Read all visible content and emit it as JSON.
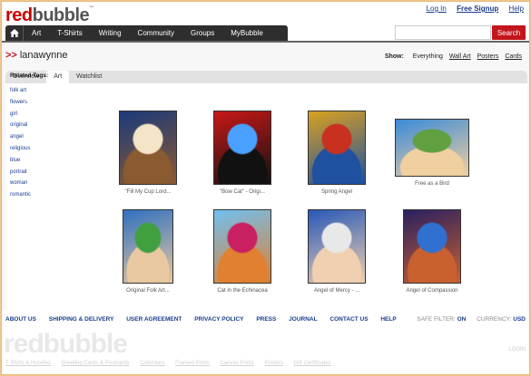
{
  "brand": {
    "part1": "red",
    "part2": "bubble",
    "mark": "™"
  },
  "top_links": [
    "Log In",
    "Free Signup",
    "Help"
  ],
  "nav": {
    "home_icon": "home-icon",
    "items": [
      "Art",
      "T-Shirts",
      "Writing",
      "Community",
      "Groups",
      "MyBubble"
    ]
  },
  "search": {
    "placeholder": "",
    "button": "Search"
  },
  "user": {
    "arrows": ">>",
    "name": "lanawynne"
  },
  "tabs": [
    "Overview",
    "Art",
    "Watchlist"
  ],
  "show": {
    "label": "Show:",
    "options": [
      "Everything",
      "Wall Art",
      "Posters",
      "Cards"
    ]
  },
  "tags": {
    "heading": "Related Tags:",
    "items": [
      "folk art",
      "flowers",
      "girl",
      "original",
      "angel",
      "religious",
      "blue",
      "portrait",
      "woman",
      "romantic"
    ]
  },
  "artworks": [
    {
      "caption": "\"Fill My Cup Lord...",
      "colors": [
        "#1c3a7a",
        "#8a5a30",
        "#f4e4c8"
      ]
    },
    {
      "caption": "\"Bow Cat\" - Origi...",
      "colors": [
        "#c81818",
        "#111111",
        "#4aa0ff"
      ]
    },
    {
      "caption": "Spring Angel",
      "colors": [
        "#d8a020",
        "#2050a0",
        "#c83020"
      ]
    },
    {
      "caption": "Free as a Bird",
      "colors": [
        "#3a8ad8",
        "#f0d0a0",
        "#60a040"
      ]
    },
    {
      "caption": "Original Folk Art...",
      "colors": [
        "#3070c0",
        "#e8c8a0",
        "#40a040"
      ]
    },
    {
      "caption": "Cat in the Echinacea",
      "colors": [
        "#70c0f0",
        "#e08030",
        "#c82060"
      ]
    },
    {
      "caption": "Angel of Mercy - ...",
      "colors": [
        "#2858b8",
        "#f0d0b0",
        "#e8e8e8"
      ]
    },
    {
      "caption": "Angel of Compassion",
      "colors": [
        "#2a2060",
        "#c86030",
        "#3070d0"
      ]
    }
  ],
  "footer": {
    "links": [
      "ABOUT US",
      "SHIPPING & DELIVERY",
      "USER AGREEMENT",
      "PRIVACY POLICY",
      "PRESS",
      "JOURNAL",
      "CONTACT US",
      "HELP"
    ],
    "safe_filter_label": "SAFE FILTER:",
    "safe_filter_value": "ON",
    "currency_label": "CURRENCY:",
    "currency_value": "USD",
    "logo": "redbubble",
    "login": "LOGIN",
    "bottom": [
      "T-Shirts & Hoodies",
      "Greeting Cards & Postcards",
      "Calendars",
      "Framed Prints",
      "Canvas Prints",
      "Posters",
      "Gift Certificates"
    ]
  }
}
